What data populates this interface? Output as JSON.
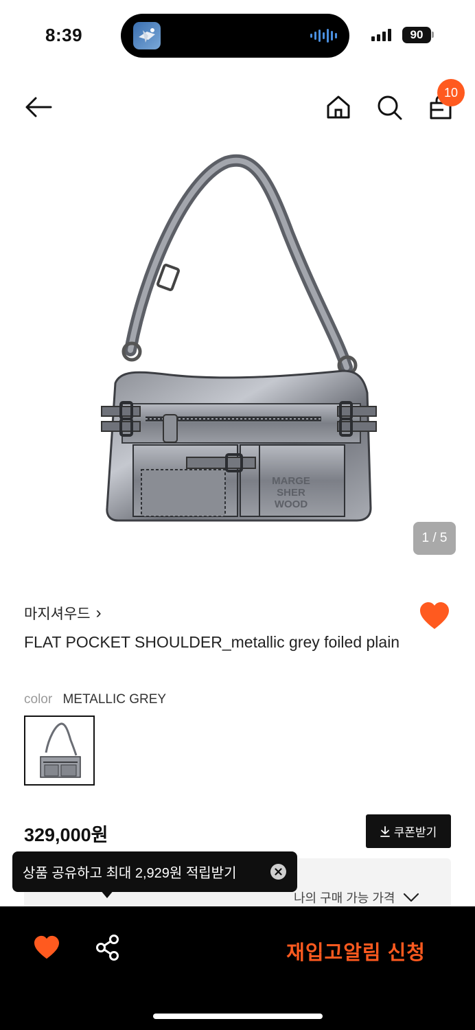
{
  "status_bar": {
    "time": "8:39",
    "battery": "90"
  },
  "nav": {
    "back_icon": "arrow-left-icon",
    "home_icon": "home-icon",
    "search_icon": "search-icon",
    "cart_icon": "shopping-bag-icon",
    "cart_count": "10"
  },
  "gallery": {
    "page_indicator": "1 / 5",
    "bag_embossed_text": [
      "MARGE",
      "SHER",
      "WOOD"
    ]
  },
  "product": {
    "brand": "마지셔우드",
    "brand_chevron": "›",
    "title": "FLAT POCKET SHOULDER_metallic grey foiled plain",
    "color_label": "color",
    "color_value": "METALLIC GREY",
    "price": "329,000원",
    "coupon_label": "쿠폰받기",
    "buyable_price_label": "나의 구매 가능 가격",
    "like_color": "#ff5a1f"
  },
  "toast": {
    "message": "상품 공유하고 최대 2,929원 적립받기"
  },
  "bottom_bar": {
    "restock_label": "재입고알림 신청",
    "accent_color": "#ff5a1f"
  }
}
